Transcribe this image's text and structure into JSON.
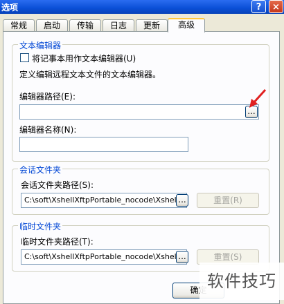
{
  "window": {
    "title": "选项",
    "help": "?",
    "close": "×"
  },
  "tabs": [
    "常规",
    "启动",
    "传输",
    "日志",
    "更新",
    "高级"
  ],
  "editor_group": {
    "legend": "文本编辑器",
    "checkbox_label": "将记事本用作文本编辑器(U)",
    "checkbox_checked": false,
    "description": "定义编辑远程文本文件的文本编辑器。",
    "path_label": "编辑器路径(E):",
    "path_value": "",
    "browse": "...",
    "name_label": "编辑器名称(N):",
    "name_value": ""
  },
  "session_group": {
    "legend": "会话文件夹",
    "path_label": "会话文件夹路径(S):",
    "path_value": "C:\\soft\\XshellXftpPortable_nocode\\XshellXftp",
    "browse": "...",
    "reset": "重置(R)"
  },
  "temp_group": {
    "legend": "临时文件夹",
    "path_label": "临时文件夹路径(T):",
    "path_value": "C:\\soft\\XshellXftpPortable_nocode\\XshellXftp",
    "browse": "...",
    "reset": "重置(S)"
  },
  "footer": {
    "ok": "确定"
  },
  "watermark": "软件技巧",
  "colors": {
    "arrow": "#e02020",
    "legend": "#0046d5",
    "titlebar": "#0a4fd6"
  }
}
